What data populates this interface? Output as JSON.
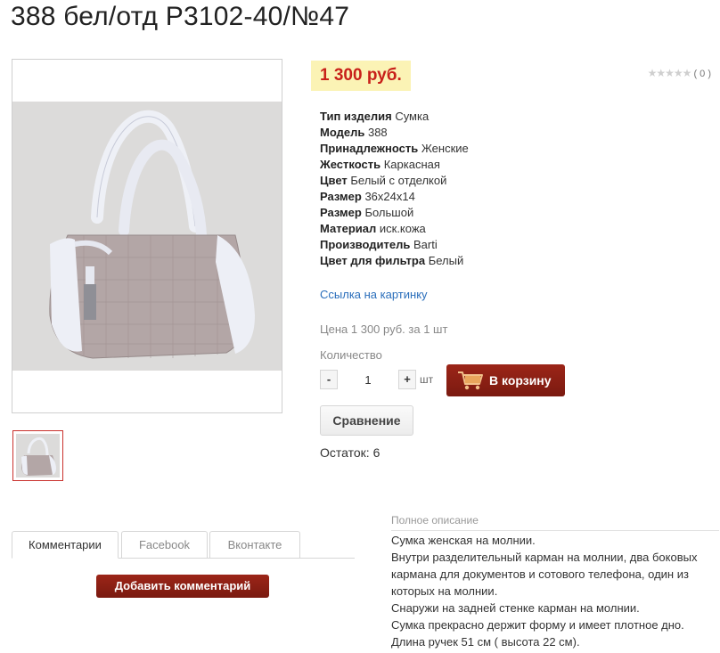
{
  "title": "388 бел/отд Р3102-40/№47",
  "price": "1 300 руб.",
  "rating": {
    "stars": "★★★★★",
    "count": "( 0 )"
  },
  "properties": [
    {
      "key": "Тип изделия",
      "value": "Сумка"
    },
    {
      "key": "Модель",
      "value": "388"
    },
    {
      "key": "Принадлежность",
      "value": "Женские"
    },
    {
      "key": "Жесткость",
      "value": "Каркасная"
    },
    {
      "key": "Цвет",
      "value": "Белый с отделкой"
    },
    {
      "key": "Размер",
      "value": "36х24х14"
    },
    {
      "key": "Размер",
      "value": "Большой"
    },
    {
      "key": "Материал",
      "value": "иск.кожа"
    },
    {
      "key": "Производитель",
      "value": "Barti"
    },
    {
      "key": "Цвет для фильтра",
      "value": "Белый"
    }
  ],
  "image_link": "Ссылка на картинку",
  "price_line": "Цена 1 300 руб. за 1 шт",
  "quantity": {
    "label": "Количество",
    "minus": "-",
    "plus": "+",
    "value": "1",
    "unit": "шт"
  },
  "cart_button": "В корзину",
  "compare_button": "Сравнение",
  "stock": "Остаток: 6",
  "tabs": [
    {
      "label": "Комментарии"
    },
    {
      "label": "Facebook"
    },
    {
      "label": "Вконтакте"
    }
  ],
  "add_comment": "Добавить комментарий",
  "description": {
    "label": "Полное описание",
    "lines": [
      "Сумка женская на молнии.",
      "Внутри разделительный карман на молнии, два боковых",
      "кармана для документов и сотового телефона, один из",
      "которых на молнии.",
      "Снаружи на задней стенке карман на молнии.",
      "Сумка прекрасно держит форму и имеет плотное дно.",
      "Длина ручек 51 см ( высота 22 см)."
    ]
  },
  "colors": {
    "price_bg": "#fbf3b5",
    "price_text": "#c8211a",
    "button_red": "#8b1f14",
    "link": "#2a6ebb"
  }
}
